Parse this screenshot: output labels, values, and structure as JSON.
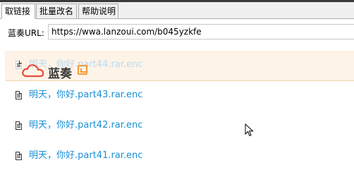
{
  "tabs": [
    {
      "label": "取链接"
    },
    {
      "label": "批量改名"
    },
    {
      "label": "帮助说明"
    }
  ],
  "url": {
    "label": "蓝奏URL:",
    "value": "https://wwa.lanzoui.com/b045yzkfe"
  },
  "files": [
    {
      "name": "明天，你好.part44.rar.enc"
    },
    {
      "name": "明天，你好.part43.rar.enc"
    },
    {
      "name": "明天，你好.part42.rar.enc"
    },
    {
      "name": "明天，你好.part41.rar.enc"
    }
  ],
  "watermark": {
    "text": "蓝奏"
  },
  "colors": {
    "link": "#1a8fd6",
    "highlight_bg": "#fdf3e7",
    "watermark_accent": "#f39a3a",
    "cloud_red": "#e74c3c"
  }
}
